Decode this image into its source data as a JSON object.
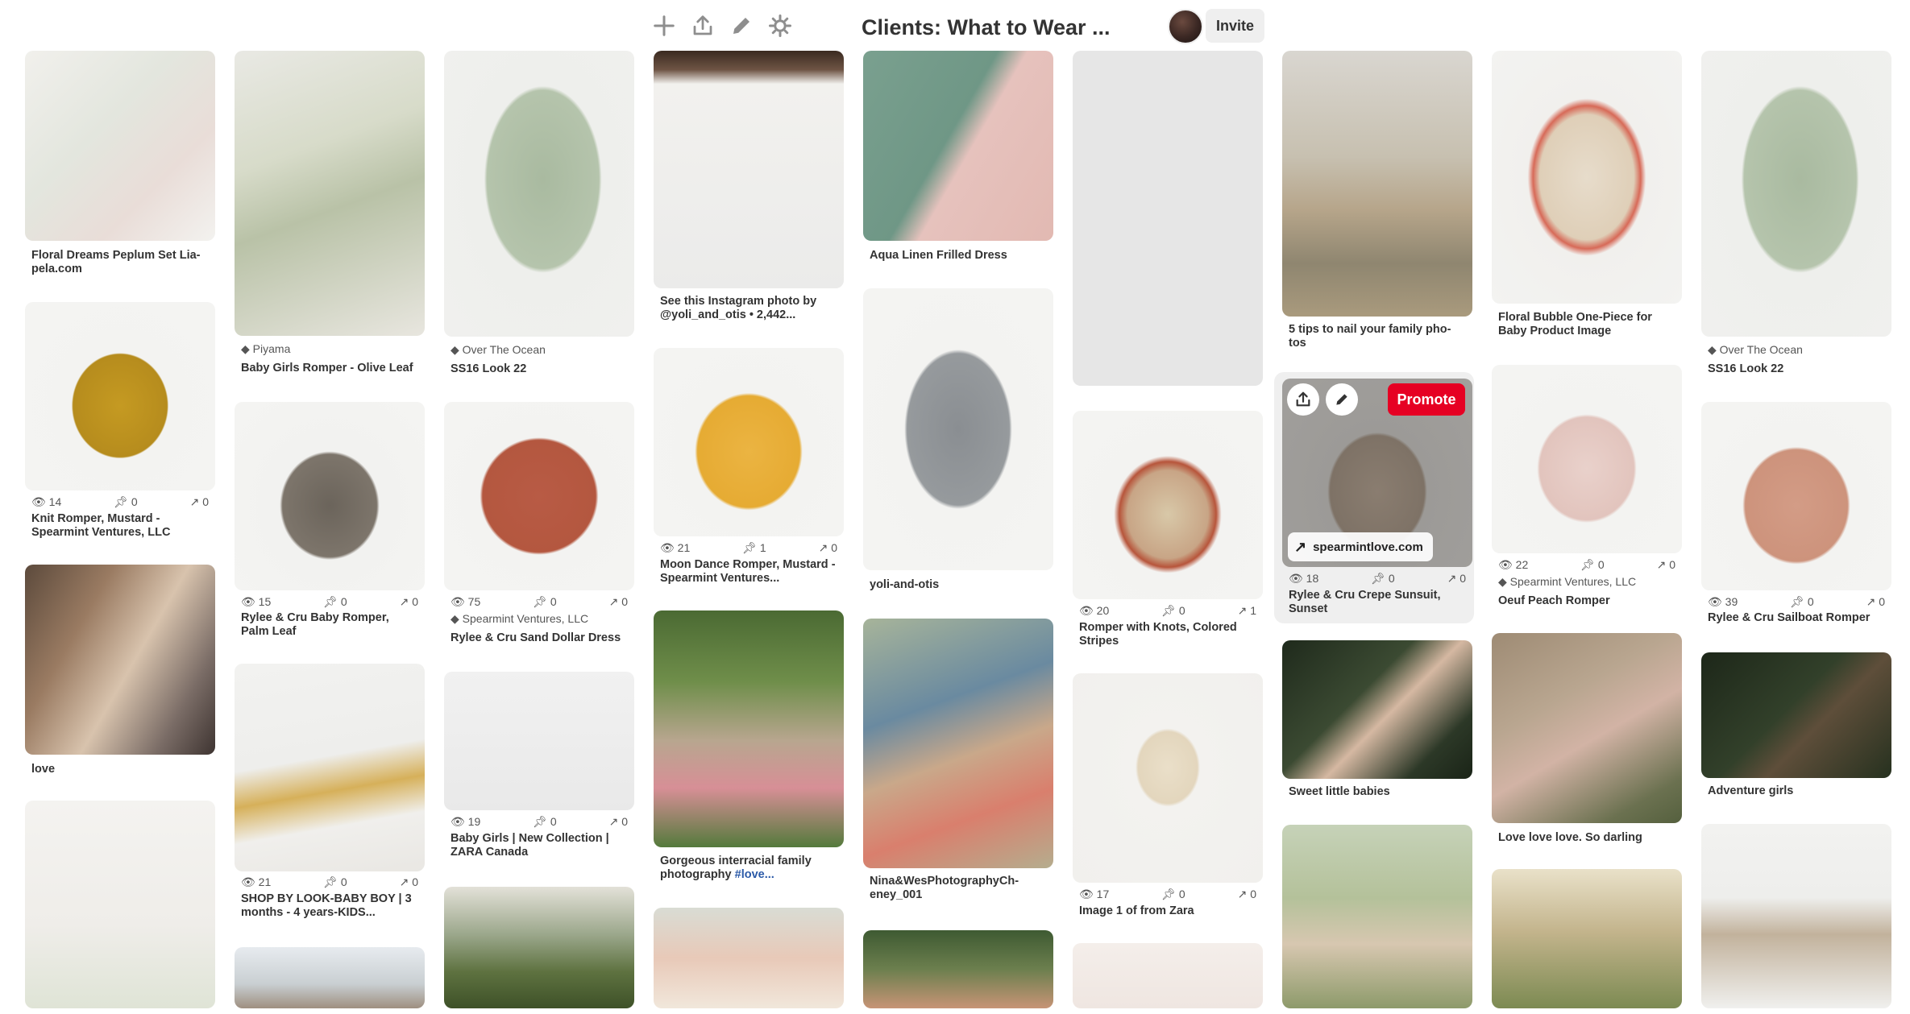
{
  "toolbar": {
    "icons": [
      "plus-icon",
      "upload-icon",
      "pencil-icon",
      "settings-icon"
    ],
    "board_title": "Clients: What to Wear ...",
    "invite_label": "Invite"
  },
  "hover_card": {
    "promote_label": "Promote",
    "domain": "spearmintlove.com"
  },
  "pins": [
    {
      "title": "Floral Dreams Peplum Set Lia-pela.com"
    },
    {
      "title": "Knit Romper, Mustard - Spearmint Ventures, LLC",
      "views": "14",
      "saves": "0",
      "clicks": "0"
    },
    {
      "title": "love"
    },
    {
      "source": "Piyama",
      "title": "Baby Girls Romper - Olive Leaf"
    },
    {
      "title": "Rylee & Cru Baby Romper, Palm Leaf",
      "views": "15",
      "saves": "0",
      "clicks": "0"
    },
    {
      "title": "SHOP BY LOOK-BABY BOY | 3 months - 4 years-KIDS...",
      "views": "21",
      "saves": "0",
      "clicks": "0"
    },
    {
      "source": "Over The Ocean",
      "title": "SS16 Look 22"
    },
    {
      "source": "Spearmint Ventures, LLC",
      "title": "Rylee & Cru Sand Dollar Dress",
      "views": "75",
      "saves": "0",
      "clicks": "0"
    },
    {
      "title": "Baby Girls | New Collection | ZARA Canada",
      "views": "19",
      "saves": "0",
      "clicks": "0"
    },
    {
      "title": "See this Instagram photo by @yoli_and_otis • 2,442..."
    },
    {
      "title": "Moon Dance Romper, Mustard - Spearmint Ventures...",
      "views": "21",
      "saves": "1",
      "clicks": "0"
    },
    {
      "title": "Gorgeous interracial family photography ",
      "tag": "#love..."
    },
    {
      "title": "Aqua Linen Frilled Dress"
    },
    {
      "title": "yoli-and-otis"
    },
    {
      "title": "Nina&WesPhotographyCh-eney_001"
    },
    {
      "title": "Romper with Knots, Colored Stripes",
      "views": "20",
      "saves": "0",
      "clicks": "1"
    },
    {
      "title": "Image 1 of from Zara",
      "views": "17",
      "saves": "0",
      "clicks": "0"
    },
    {
      "title": "5 tips to nail your family pho-tos"
    },
    {
      "title": "Rylee & Cru Crepe Sunsuit, Sunset",
      "views": "18",
      "saves": "0",
      "clicks": "0"
    },
    {
      "title": "Sweet little babies"
    },
    {
      "title": "Floral Bubble One-Piece for Baby Product Image"
    },
    {
      "source": "Spearmint Ventures, LLC",
      "title": "Oeuf Peach Romper",
      "views": "22",
      "saves": "0",
      "clicks": "0"
    },
    {
      "title": "Love love love. So darling"
    },
    {
      "source": "Over The Ocean",
      "title": "SS16 Look 22"
    },
    {
      "title": "Rylee & Cru Sailboat Romper",
      "views": "39",
      "saves": "0",
      "clicks": "0"
    },
    {
      "title": "Adventure girls"
    }
  ]
}
